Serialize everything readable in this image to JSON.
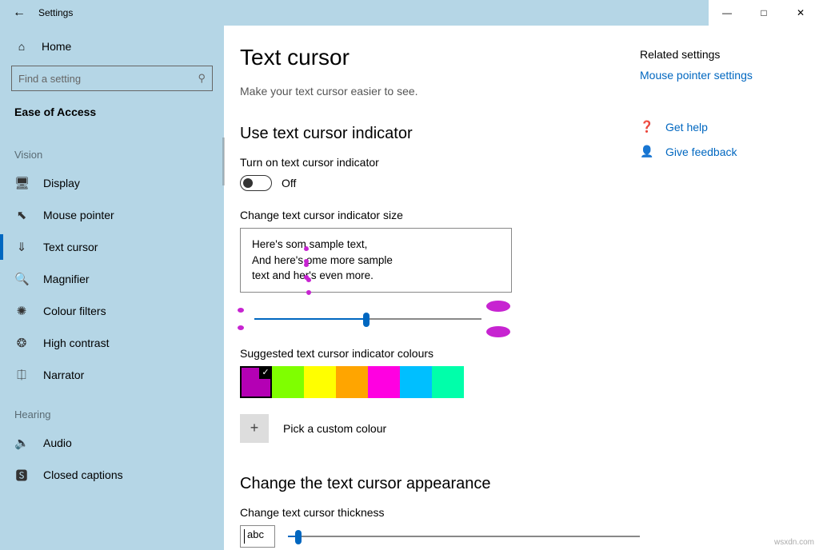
{
  "window": {
    "title": "Settings"
  },
  "sidebar": {
    "home": "Home",
    "search_placeholder": "Find a setting",
    "category": "Ease of Access",
    "groups": {
      "vision": "Vision",
      "hearing": "Hearing"
    },
    "items": {
      "display": "Display",
      "mouse_pointer": "Mouse pointer",
      "text_cursor": "Text cursor",
      "magnifier": "Magnifier",
      "colour_filters": "Colour filters",
      "high_contrast": "High contrast",
      "narrator": "Narrator",
      "audio": "Audio",
      "closed_captions": "Closed captions"
    }
  },
  "page": {
    "title": "Text cursor",
    "subtitle": "Make your text cursor easier to see.",
    "section_indicator": "Use text cursor indicator",
    "toggle_label": "Turn on text cursor indicator",
    "toggle_state": "Off",
    "size_label": "Change text cursor indicator size",
    "preview_line1a": "Here's som",
    "preview_line1b": " sample text,",
    "preview_line2a": "And here's ",
    "preview_line2b": "ome more sample",
    "preview_line3a": "text and her",
    "preview_line3b": "'s even more.",
    "suggested_label": "Suggested text cursor indicator colours",
    "colours": [
      "#b400b4",
      "#7fff00",
      "#ffff00",
      "#ffa500",
      "#ff00e1",
      "#00bfff",
      "#00ffaa"
    ],
    "custom_label": "Pick a custom colour",
    "section_appearance": "Change the text cursor appearance",
    "thickness_label": "Change text cursor thickness",
    "thickness_preview": "abc"
  },
  "right": {
    "related": "Related settings",
    "mouse_link": "Mouse pointer settings",
    "help": "Get help",
    "feedback": "Give feedback"
  },
  "watermark": "wsxdn.com"
}
